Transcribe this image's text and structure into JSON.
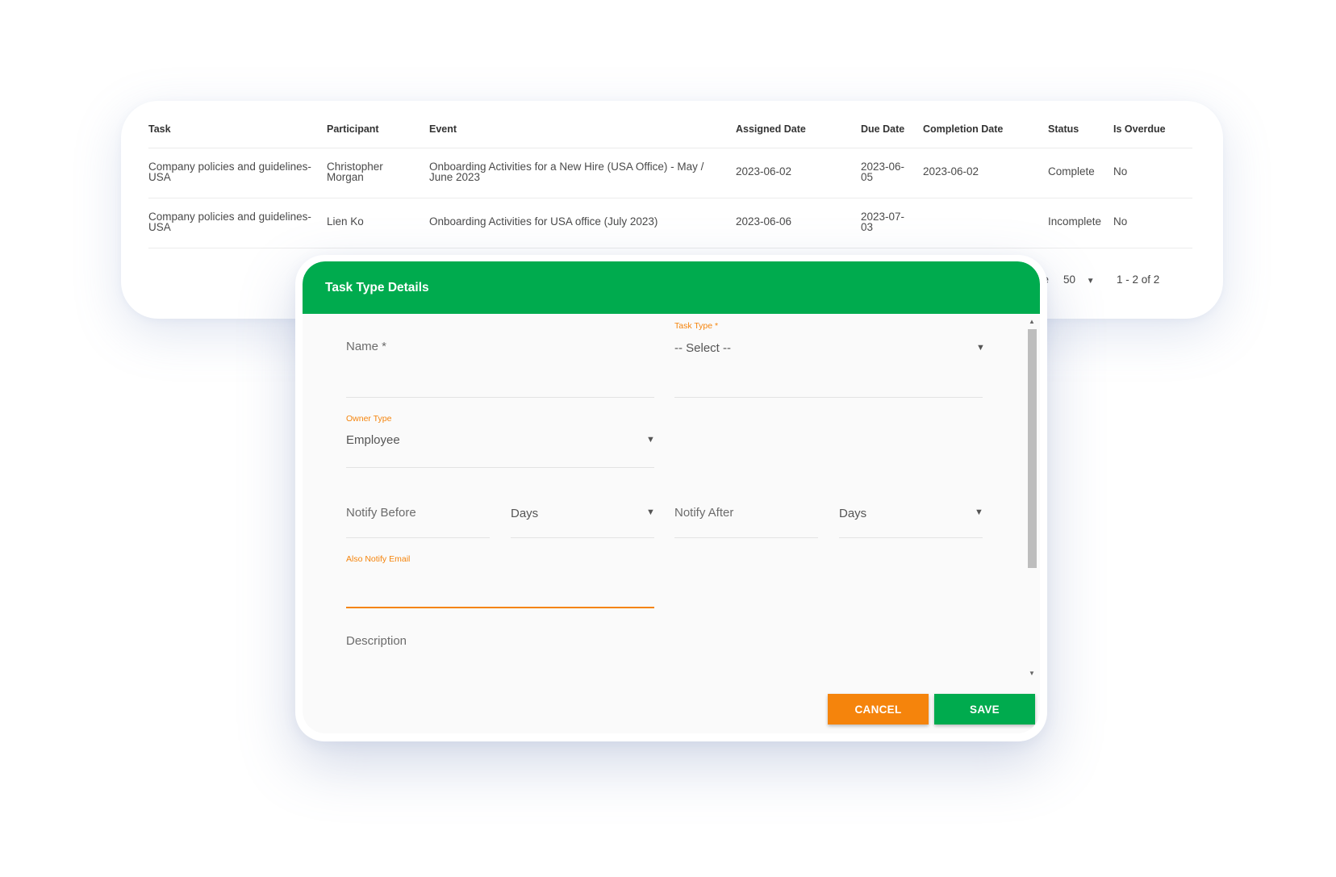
{
  "table": {
    "headers": {
      "task": "Task",
      "participant": "Participant",
      "event": "Event",
      "assigned": "Assigned Date",
      "due": "Due Date",
      "completion": "Completion Date",
      "status": "Status",
      "overdue": "Is Overdue"
    },
    "rows": [
      {
        "task_l1": "Company policies and guidelines-",
        "task_l2": "USA",
        "participant_l1": "Christopher",
        "participant_l2": "Morgan",
        "event_l1": "Onboarding Activities for a New Hire (USA Office) - May /",
        "event_l2": "June 2023",
        "assigned": "2023-06-02",
        "due_l1": "2023-06-",
        "due_l2": "05",
        "completion": "2023-06-02",
        "status": "Complete",
        "overdue": "No"
      },
      {
        "task_l1": "Company policies and guidelines-",
        "task_l2": "USA",
        "participant": "Lien Ko",
        "event": "Onboarding Activities for USA office (July 2023)",
        "assigned": "2023-06-06",
        "due_l1": "2023-07-",
        "due_l2": "03",
        "completion": "",
        "status": "Incomplete",
        "overdue": "No"
      }
    ],
    "pager": {
      "per_page_fragment": "ge",
      "page_size": "50",
      "range": "1 - 2 of 2"
    }
  },
  "modal": {
    "title": "Task Type Details",
    "name_placeholder": "Name *",
    "task_type_label": "Task Type *",
    "task_type_value": "-- Select --",
    "owner_type_label": "Owner Type",
    "owner_type_value": "Employee",
    "notify_before_placeholder": "Notify Before",
    "notify_before_unit": "Days",
    "notify_after_placeholder": "Notify After",
    "notify_after_unit": "Days",
    "also_notify_email_label": "Also Notify Email",
    "also_notify_email_value": "",
    "description_placeholder": "Description",
    "cancel_label": "CANCEL",
    "save_label": "SAVE"
  },
  "colors": {
    "accent_green": "#00ab4e",
    "accent_orange": "#f5840c"
  },
  "icons": {
    "dropdown": "caret-down-icon",
    "scroll_up": "scroll-up-arrow-icon",
    "scroll_down": "scroll-down-arrow-icon"
  }
}
